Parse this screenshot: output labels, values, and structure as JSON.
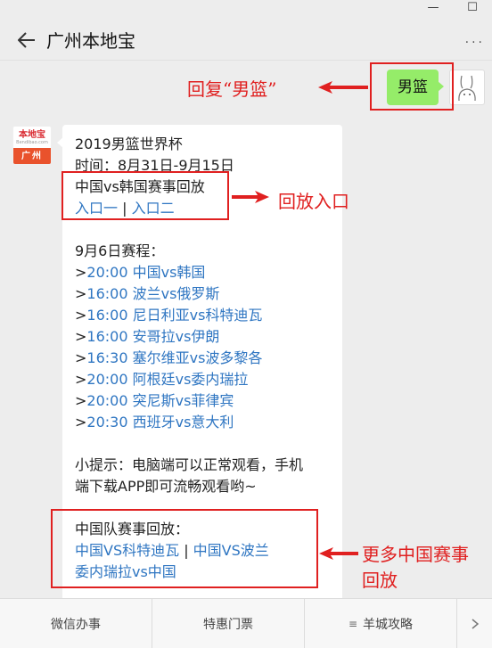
{
  "window": {
    "min_icon": "minimize-icon",
    "max_icon": "maximize-icon"
  },
  "header": {
    "title": "广州本地宝",
    "more": "···"
  },
  "user_message": {
    "text": "男篮"
  },
  "bot_avatar": {
    "logo_text": "本地宝",
    "logo_sub": "Bendibao.com",
    "city": "广州"
  },
  "bot_message": {
    "line1": "2019男篮世界杯",
    "line2": "时间：8月31日-9月15日",
    "replay_title": "中国vs韩国赛事回放",
    "entry1": "入口一",
    "separator": " | ",
    "entry2": "入口二",
    "schedule_title": "9月6日赛程：",
    "schedule": [
      {
        "prefix": ">",
        "text": "20:00 中国vs韩国"
      },
      {
        "prefix": ">",
        "text": "16:00 波兰vs俄罗斯"
      },
      {
        "prefix": ">",
        "text": "16:00 尼日利亚vs科特迪瓦"
      },
      {
        "prefix": ">",
        "text": "16:00 安哥拉vs伊朗"
      },
      {
        "prefix": ">",
        "text": "16:30 塞尔维亚vs波多黎各"
      },
      {
        "prefix": ">",
        "text": "20:00 阿根廷vs委内瑞拉"
      },
      {
        "prefix": ">",
        "text": "20:00 突尼斯vs菲律宾"
      },
      {
        "prefix": ">",
        "text": "20:30 西班牙vs意大利"
      }
    ],
    "tip1": "小提示：电脑端可以正常观看，手机",
    "tip2": "端下载APP即可流畅观看哟~",
    "team_replay_title": "中国队赛事回放：",
    "team_link1": "中国VS科特迪瓦",
    "team_sep": " | ",
    "team_link2": "中国VS波兰",
    "team_link3": "委内瑞拉vs中国"
  },
  "annotations": {
    "reply": "回复“男篮”",
    "replay_entry": "回放入口",
    "more_line1": "更多中国赛事",
    "more_line2": "回放"
  },
  "bottom_menu": [
    {
      "label": "微信办事",
      "icon": ""
    },
    {
      "label": "特惠门票",
      "icon": ""
    },
    {
      "label": "羊城攻略",
      "icon": "≡"
    }
  ],
  "colors": {
    "accent_red": "#e02020",
    "link_blue": "#2f76c2",
    "user_bubble": "#95ec69"
  }
}
